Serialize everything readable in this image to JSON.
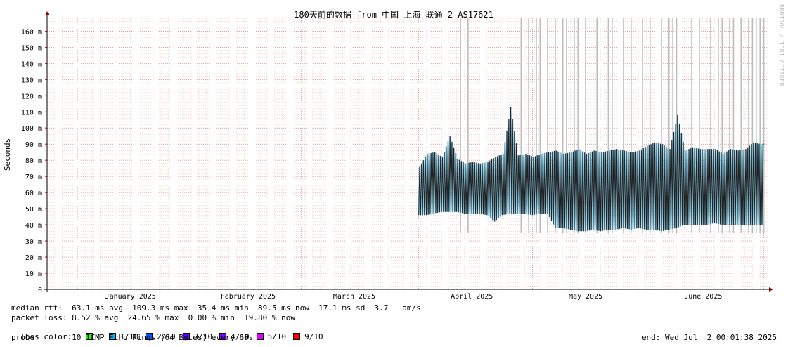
{
  "watermark": "RRDTOOL / TOBI OETIKER",
  "chart_data": {
    "type": "line",
    "title": "180天前的数据 from 中国 上海 联通-2 AS17621",
    "ylabel": "Seconds",
    "ylim": [
      0,
      168
    ],
    "y_ticks": [
      {
        "v": 0,
        "label": "0"
      },
      {
        "v": 10,
        "label": "10 m"
      },
      {
        "v": 20,
        "label": "20 m"
      },
      {
        "v": 30,
        "label": "30 m"
      },
      {
        "v": 40,
        "label": "40 m"
      },
      {
        "v": 50,
        "label": "50 m"
      },
      {
        "v": 60,
        "label": "60 m"
      },
      {
        "v": 70,
        "label": "70 m"
      },
      {
        "v": 80,
        "label": "80 m"
      },
      {
        "v": 90,
        "label": "90 m"
      },
      {
        "v": 100,
        "label": "100 m"
      },
      {
        "v": 110,
        "label": "110 m"
      },
      {
        "v": 120,
        "label": "120 m"
      },
      {
        "v": 130,
        "label": "130 m"
      },
      {
        "v": 140,
        "label": "140 m"
      },
      {
        "v": 150,
        "label": "150 m"
      },
      {
        "v": 160,
        "label": "160 m"
      }
    ],
    "x_range": [
      "2024-12-24",
      "2025-07-02"
    ],
    "x_ticks": [
      {
        "date": "2025-01-15",
        "label": "January 2025"
      },
      {
        "date": "2025-02-15",
        "label": "February 2025"
      },
      {
        "date": "2025-03-15",
        "label": "March 2025"
      },
      {
        "date": "2025-04-15",
        "label": "April 2025"
      },
      {
        "date": "2025-05-15",
        "label": "May 2025"
      },
      {
        "date": "2025-06-15",
        "label": "June 2025"
      }
    ],
    "grid": true,
    "series": [
      {
        "color": "#222222",
        "points": [
          {
            "date": "2025-04-01",
            "min": 46,
            "max": 76
          },
          {
            "date": "2025-04-03",
            "min": 46,
            "max": 84
          },
          {
            "date": "2025-04-05",
            "min": 47,
            "max": 85
          },
          {
            "date": "2025-04-07",
            "min": 48,
            "max": 82
          },
          {
            "date": "2025-04-09",
            "min": 48,
            "max": 95
          },
          {
            "date": "2025-04-11",
            "min": 48,
            "max": 81
          },
          {
            "date": "2025-04-13",
            "min": 47,
            "max": 78
          },
          {
            "date": "2025-04-15",
            "min": 47,
            "max": 79
          },
          {
            "date": "2025-04-17",
            "min": 47,
            "max": 78
          },
          {
            "date": "2025-04-19",
            "min": 46,
            "max": 79
          },
          {
            "date": "2025-04-21",
            "min": 42,
            "max": 82
          },
          {
            "date": "2025-04-23",
            "min": 46,
            "max": 84
          },
          {
            "date": "2025-04-25",
            "min": 47,
            "max": 113
          },
          {
            "date": "2025-04-27",
            "min": 47,
            "max": 83
          },
          {
            "date": "2025-04-29",
            "min": 47,
            "max": 84
          },
          {
            "date": "2025-05-01",
            "min": 46,
            "max": 82
          },
          {
            "date": "2025-05-03",
            "min": 47,
            "max": 84
          },
          {
            "date": "2025-05-05",
            "min": 47,
            "max": 85
          },
          {
            "date": "2025-05-07",
            "min": 38,
            "max": 86
          },
          {
            "date": "2025-05-09",
            "min": 38,
            "max": 84
          },
          {
            "date": "2025-05-11",
            "min": 37,
            "max": 85
          },
          {
            "date": "2025-05-13",
            "min": 36,
            "max": 87
          },
          {
            "date": "2025-05-15",
            "min": 36,
            "max": 84
          },
          {
            "date": "2025-05-17",
            "min": 37,
            "max": 86
          },
          {
            "date": "2025-05-19",
            "min": 36,
            "max": 85
          },
          {
            "date": "2025-05-21",
            "min": 37,
            "max": 86
          },
          {
            "date": "2025-05-23",
            "min": 37,
            "max": 87
          },
          {
            "date": "2025-05-25",
            "min": 38,
            "max": 86
          },
          {
            "date": "2025-05-27",
            "min": 37,
            "max": 85
          },
          {
            "date": "2025-05-29",
            "min": 38,
            "max": 86
          },
          {
            "date": "2025-05-31",
            "min": 37,
            "max": 89
          },
          {
            "date": "2025-06-02",
            "min": 37,
            "max": 91
          },
          {
            "date": "2025-06-04",
            "min": 36,
            "max": 90
          },
          {
            "date": "2025-06-06",
            "min": 37,
            "max": 87
          },
          {
            "date": "2025-06-08",
            "min": 38,
            "max": 108
          },
          {
            "date": "2025-06-10",
            "min": 40,
            "max": 86
          },
          {
            "date": "2025-06-12",
            "min": 40,
            "max": 88
          },
          {
            "date": "2025-06-14",
            "min": 40,
            "max": 87
          },
          {
            "date": "2025-06-16",
            "min": 40,
            "max": 87
          },
          {
            "date": "2025-06-18",
            "min": 41,
            "max": 87
          },
          {
            "date": "2025-06-20",
            "min": 40,
            "max": 84
          },
          {
            "date": "2025-06-22",
            "min": 40,
            "max": 87
          },
          {
            "date": "2025-06-24",
            "min": 40,
            "max": 86
          },
          {
            "date": "2025-06-26",
            "min": 40,
            "max": 87
          },
          {
            "date": "2025-06-28",
            "min": 40,
            "max": 91
          },
          {
            "date": "2025-06-30",
            "min": 40,
            "max": 90
          },
          {
            "date": "2025-07-01",
            "min": 40,
            "max": 90
          }
        ]
      }
    ],
    "loss_spike_dates": [
      "2025-04-12",
      "2025-04-14",
      "2025-04-28",
      "2025-04-30",
      "2025-05-02",
      "2025-05-03",
      "2025-05-05",
      "2025-05-07",
      "2025-05-09",
      "2025-05-10",
      "2025-05-12",
      "2025-05-13",
      "2025-05-15",
      "2025-05-18",
      "2025-05-21",
      "2025-05-22",
      "2025-05-25",
      "2025-05-27",
      "2025-05-30",
      "2025-06-01",
      "2025-06-04",
      "2025-06-06",
      "2025-06-07",
      "2025-06-08",
      "2025-06-12",
      "2025-06-14",
      "2025-06-17",
      "2025-06-19",
      "2025-06-20",
      "2025-06-22",
      "2025-06-23",
      "2025-06-25",
      "2025-06-27",
      "2025-06-28",
      "2025-06-29",
      "2025-06-30",
      "2025-07-01"
    ]
  },
  "stats": {
    "median_rtt": "median rtt:  63.1 ms avg  109.3 ms max  35.4 ms min  89.5 ms now  17.1 ms sd  3.7   am/s",
    "packet_loss": "packet loss: 8.52 % avg  24.65 % max  0.00 % min  19.80 % now",
    "loss_color_label": "loss color:",
    "loss_colors": [
      {
        "label": "0",
        "color": "#26ff00"
      },
      {
        "label": "1/10",
        "color": "#00b8ff"
      },
      {
        "label": "2/10",
        "color": "#0059ff"
      },
      {
        "label": "3/10",
        "color": "#5e00ff"
      },
      {
        "label": "4/10",
        "color": "#7e00ff"
      },
      {
        "label": "5/10",
        "color": "#dd00ff"
      },
      {
        "label": "9/10",
        "color": "#ff0000"
      }
    ],
    "probe": "probe:       10 ICMP Echo Pings (64 Bytes) every 60s",
    "end": "end: Wed Jul  2 00:01:38 2025"
  }
}
